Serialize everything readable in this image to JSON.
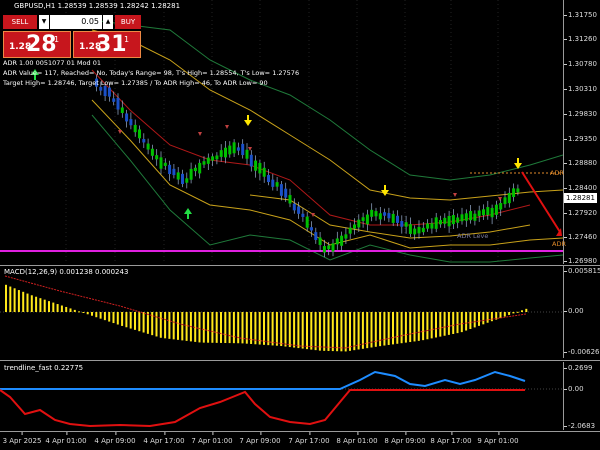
{
  "symbol_title": "GBPUSD,H1  1.28539 1.28539 1.28242 1.28281",
  "trade_panel": {
    "sell_label": "SELL",
    "buy_label": "BUY",
    "volume": "0.05",
    "dropdown_glyph": "▼",
    "up_glyph": "▲",
    "bid_small": "1.28",
    "bid_big": "28",
    "bid_sup": "1",
    "ask_small": "1.28",
    "ask_big": "31",
    "ask_sup": "1"
  },
  "info_lines": {
    "line1": "ADR 1.00 0051077 01 Mod 01",
    "line2": "ADR Value= 117, Reached= No, Today's Range= 98, T's High= 1.28554, T's Low= 1.27576",
    "line3": "Target High= 1.28746, Target Low= 1.27385 / To ADR High= 46, To ADR Low= 90"
  },
  "chart_notes": {
    "adr_high": "ADR",
    "adr_low": "ADR",
    "adr_mid": "ADR Leve"
  },
  "price_axis": {
    "ticks": [
      "1.31750",
      "1.31260",
      "1.30780",
      "1.30310",
      "1.29830",
      "1.29350",
      "1.28880",
      "1.28400",
      "1.27920",
      "1.27460",
      "1.26980"
    ],
    "current_price": "1.28281"
  },
  "macd": {
    "title": "MACD(12,26,9) 0.001238 0.000243",
    "ticks": [
      "0.005815",
      "0.00",
      "-0.006269"
    ],
    "colors": {
      "histogram": "#ffe81a",
      "signal": "#d02020"
    }
  },
  "trendline": {
    "title": "trendline_fast 0.22775",
    "ticks": [
      "0.2699",
      "0.00",
      "-2.0683"
    ],
    "colors": {
      "blue": "#1e8cff",
      "red": "#e01010"
    }
  },
  "time_axis": [
    "3 Apr 2025",
    "4 Apr 01:00",
    "4 Apr 09:00",
    "4 Apr 17:00",
    "7 Apr 01:00",
    "7 Apr 09:00",
    "7 Apr 17:00",
    "8 Apr 01:00",
    "8 Apr 09:00",
    "8 Apr 17:00",
    "9 Apr 01:00"
  ],
  "colors": {
    "bull_candle": "#00c000",
    "bear_candle": "#1a50c8",
    "wick": "#9ab0d0",
    "band_green": "#1f7a3a",
    "band_yellow": "#c9a21a",
    "ma_red": "#b01818",
    "magenta": "#e020e0",
    "signal_arrow": "#ffe600"
  }
}
